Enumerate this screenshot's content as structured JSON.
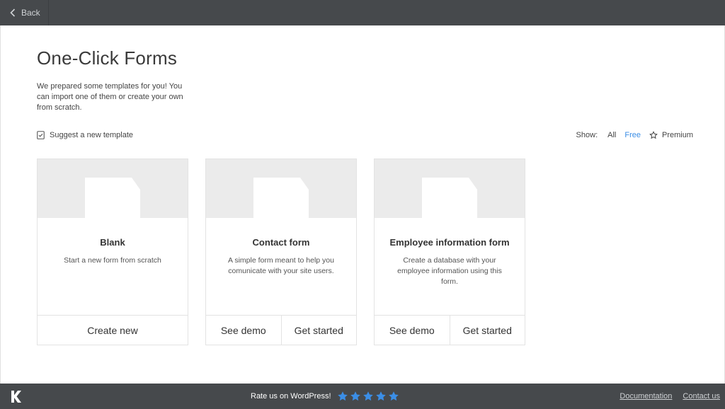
{
  "topbar": {
    "back_label": "Back"
  },
  "page": {
    "title": "One-Click Forms",
    "description": "We prepared some templates for you! You can import one of them or create your own from scratch."
  },
  "toolbar": {
    "suggest_label": "Suggest a new template",
    "show_label": "Show:",
    "filters": {
      "all": "All",
      "free": "Free",
      "premium": "Premium"
    },
    "active_filter": "Free",
    "active_color": "#3b8ee6"
  },
  "templates": [
    {
      "name": "Blank",
      "description": "Start a new form from scratch",
      "actions": [
        "Create new"
      ]
    },
    {
      "name": "Contact form",
      "description": "A simple form meant to help you comunicate with your site users.",
      "actions": [
        "See demo",
        "Get started"
      ]
    },
    {
      "name": "Employee information form",
      "description": "Create a database with your employee information using this form.",
      "actions": [
        "See demo",
        "Get started"
      ]
    }
  ],
  "footer": {
    "logo_letter": "K",
    "rate_label": "Rate us on WordPress!",
    "stars": 5,
    "star_color": "#3b8ee6",
    "links": {
      "documentation": "Documentation",
      "contact": "Contact us"
    }
  },
  "icons": [
    "chevron-left-icon",
    "checklist-icon",
    "star-outline-icon",
    "star-icon",
    "document-icon"
  ]
}
